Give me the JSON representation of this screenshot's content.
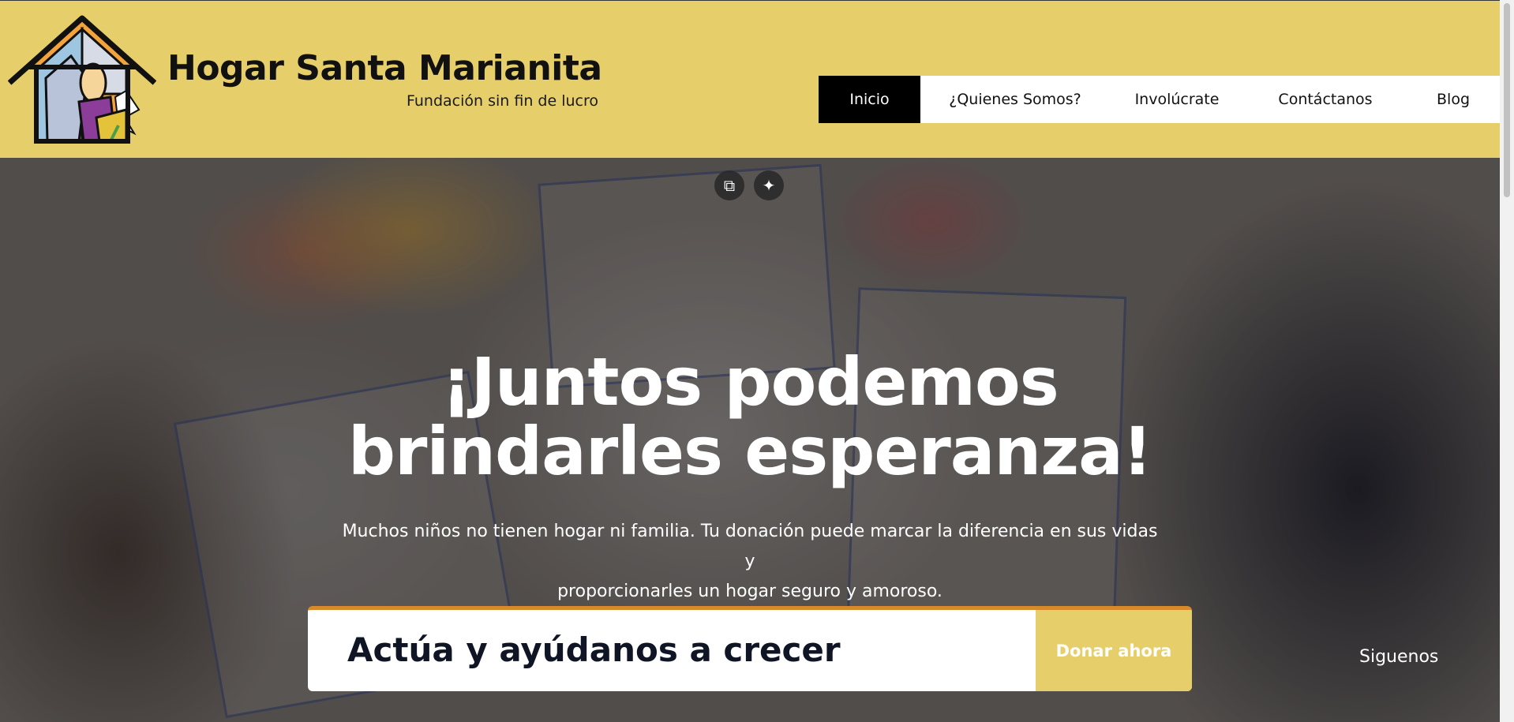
{
  "brand": {
    "title": "Hogar Santa Marianita",
    "subtitle": "Fundación sin fin de lucro",
    "logo_icon": "house-madonna-logo"
  },
  "nav": {
    "items": [
      {
        "label": "Inicio",
        "active": true
      },
      {
        "label": "¿Quienes Somos?",
        "active": false
      },
      {
        "label": "Involúcrate",
        "active": false
      },
      {
        "label": "Contáctanos",
        "active": false
      },
      {
        "label": "Blog",
        "active": false
      }
    ]
  },
  "hero": {
    "title_line1": "¡Juntos podemos",
    "title_line2": "brindarles esperanza!",
    "text_line1": "Muchos niños no tienen hogar ni familia. Tu donación puede marcar la diferencia en sus vidas y",
    "text_line2": "proporcionarles un hogar seguro y amoroso.",
    "image_tools": [
      "open-in-new-icon",
      "sparkle-icon"
    ]
  },
  "cta": {
    "title": "Actúa y ayúdanos a crecer",
    "button_label": "Donar ahora"
  },
  "social": {
    "label": "Siguenos"
  },
  "colors": {
    "header_bg": "#e6cf6a",
    "nav_active_bg": "#000000",
    "cta_accent": "#d68a2a",
    "button_bg": "#e6cf6a"
  }
}
